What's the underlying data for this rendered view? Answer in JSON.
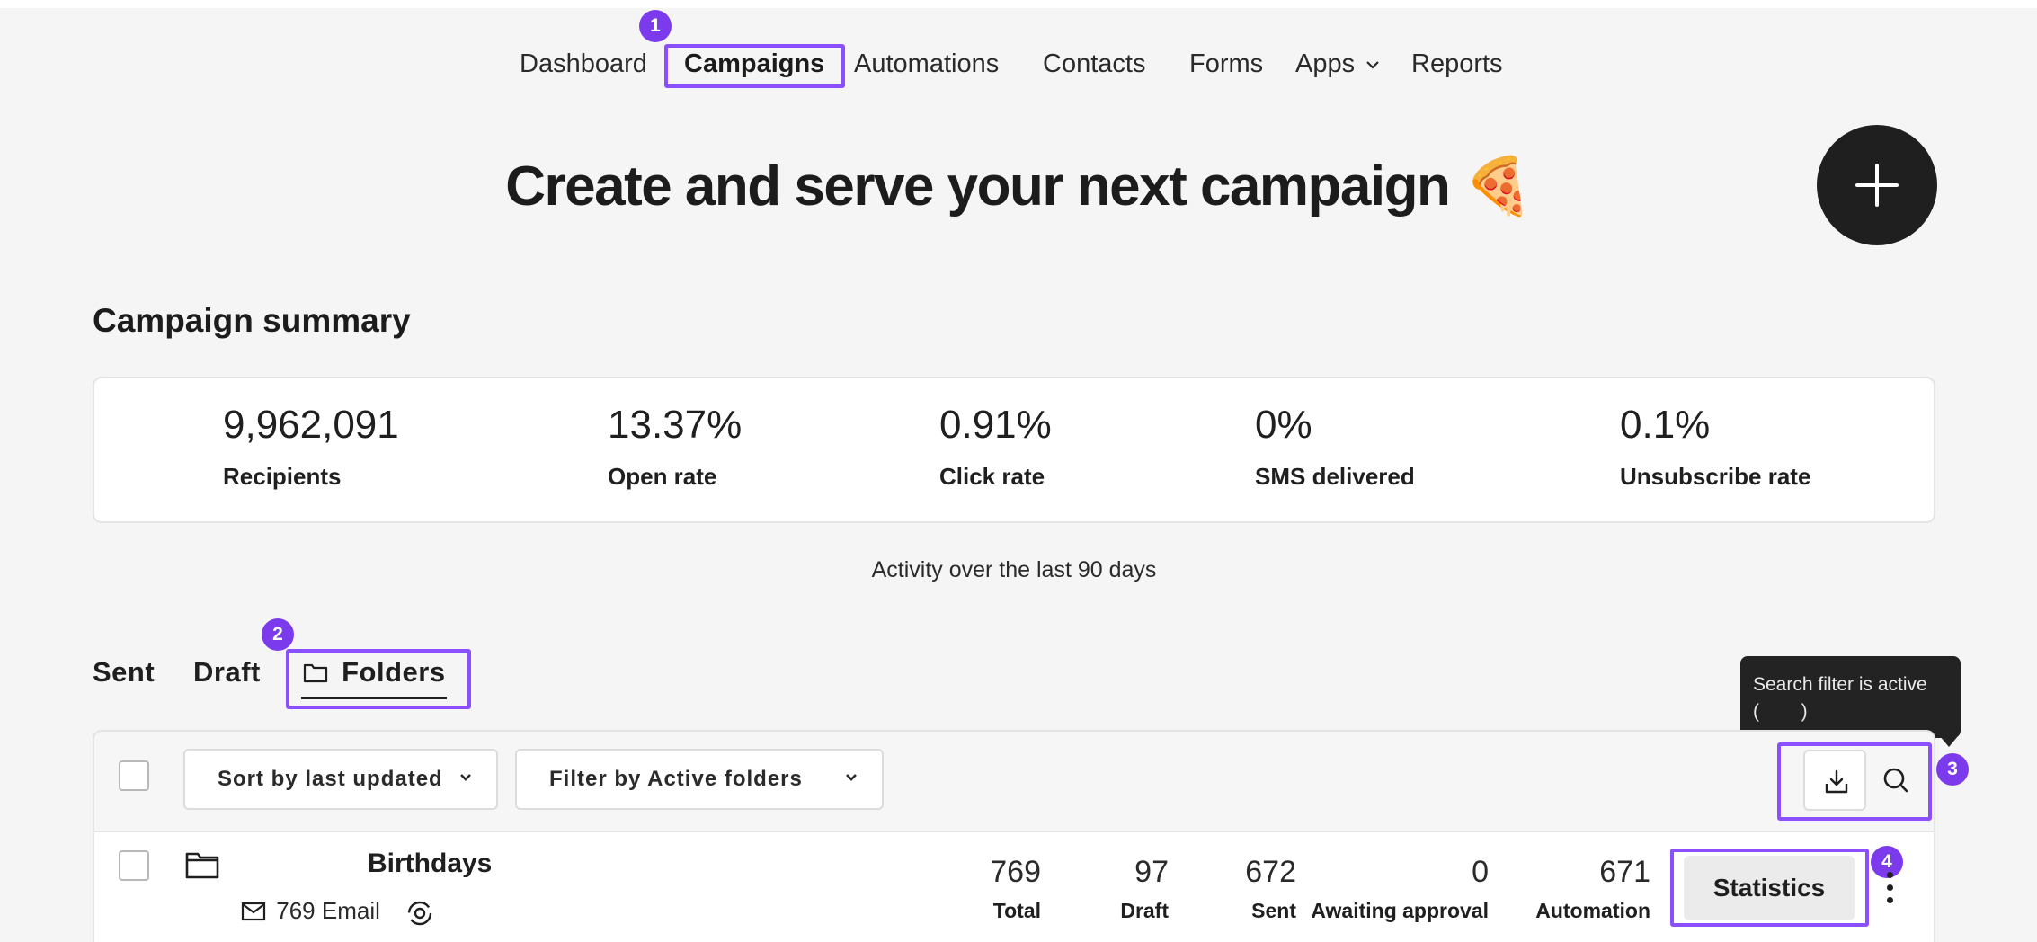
{
  "nav": {
    "items": [
      {
        "label": "Dashboard"
      },
      {
        "label": "Campaigns"
      },
      {
        "label": "Automations"
      },
      {
        "label": "Contacts"
      },
      {
        "label": "Forms"
      },
      {
        "label": "Apps"
      },
      {
        "label": "Reports"
      }
    ],
    "active": "Campaigns"
  },
  "badges": [
    "1",
    "2",
    "3",
    "4"
  ],
  "hero": {
    "title": "Create and serve your next campaign",
    "emoji": "🍕"
  },
  "summary": {
    "title": "Campaign summary",
    "metrics": [
      {
        "value": "9,962,091",
        "label": "Recipients"
      },
      {
        "value": "13.37%",
        "label": "Open rate"
      },
      {
        "value": "0.91%",
        "label": "Click rate"
      },
      {
        "value": "0%",
        "label": "SMS delivered"
      },
      {
        "value": "0.1%",
        "label": "Unsubscribe rate"
      }
    ],
    "activity_note": "Activity over the last 90 days"
  },
  "tabs": {
    "items": [
      {
        "label": "Sent"
      },
      {
        "label": "Draft"
      },
      {
        "label": "Folders"
      }
    ],
    "active": "Folders"
  },
  "toolbar": {
    "sort_label": "Sort by last updated",
    "filter_label": "Filter by Active folders",
    "tooltip_line1": "Search filter is active",
    "tooltip_line2": "(        )"
  },
  "folders": [
    {
      "name": "Birthdays",
      "sub_count": "769",
      "sub_type": "Email",
      "stats": [
        {
          "value": "769",
          "label": "Total"
        },
        {
          "value": "97",
          "label": "Draft"
        },
        {
          "value": "672",
          "label": "Sent"
        },
        {
          "value": "0",
          "label": "Awaiting approval"
        },
        {
          "value": "671",
          "label": "Automation"
        }
      ],
      "action_label": "Statistics"
    }
  ],
  "colors": {
    "highlight": "#8a4fff",
    "badge": "#7c3aed",
    "dark": "#1f1f1f",
    "page_bg": "#f5f5f5"
  }
}
